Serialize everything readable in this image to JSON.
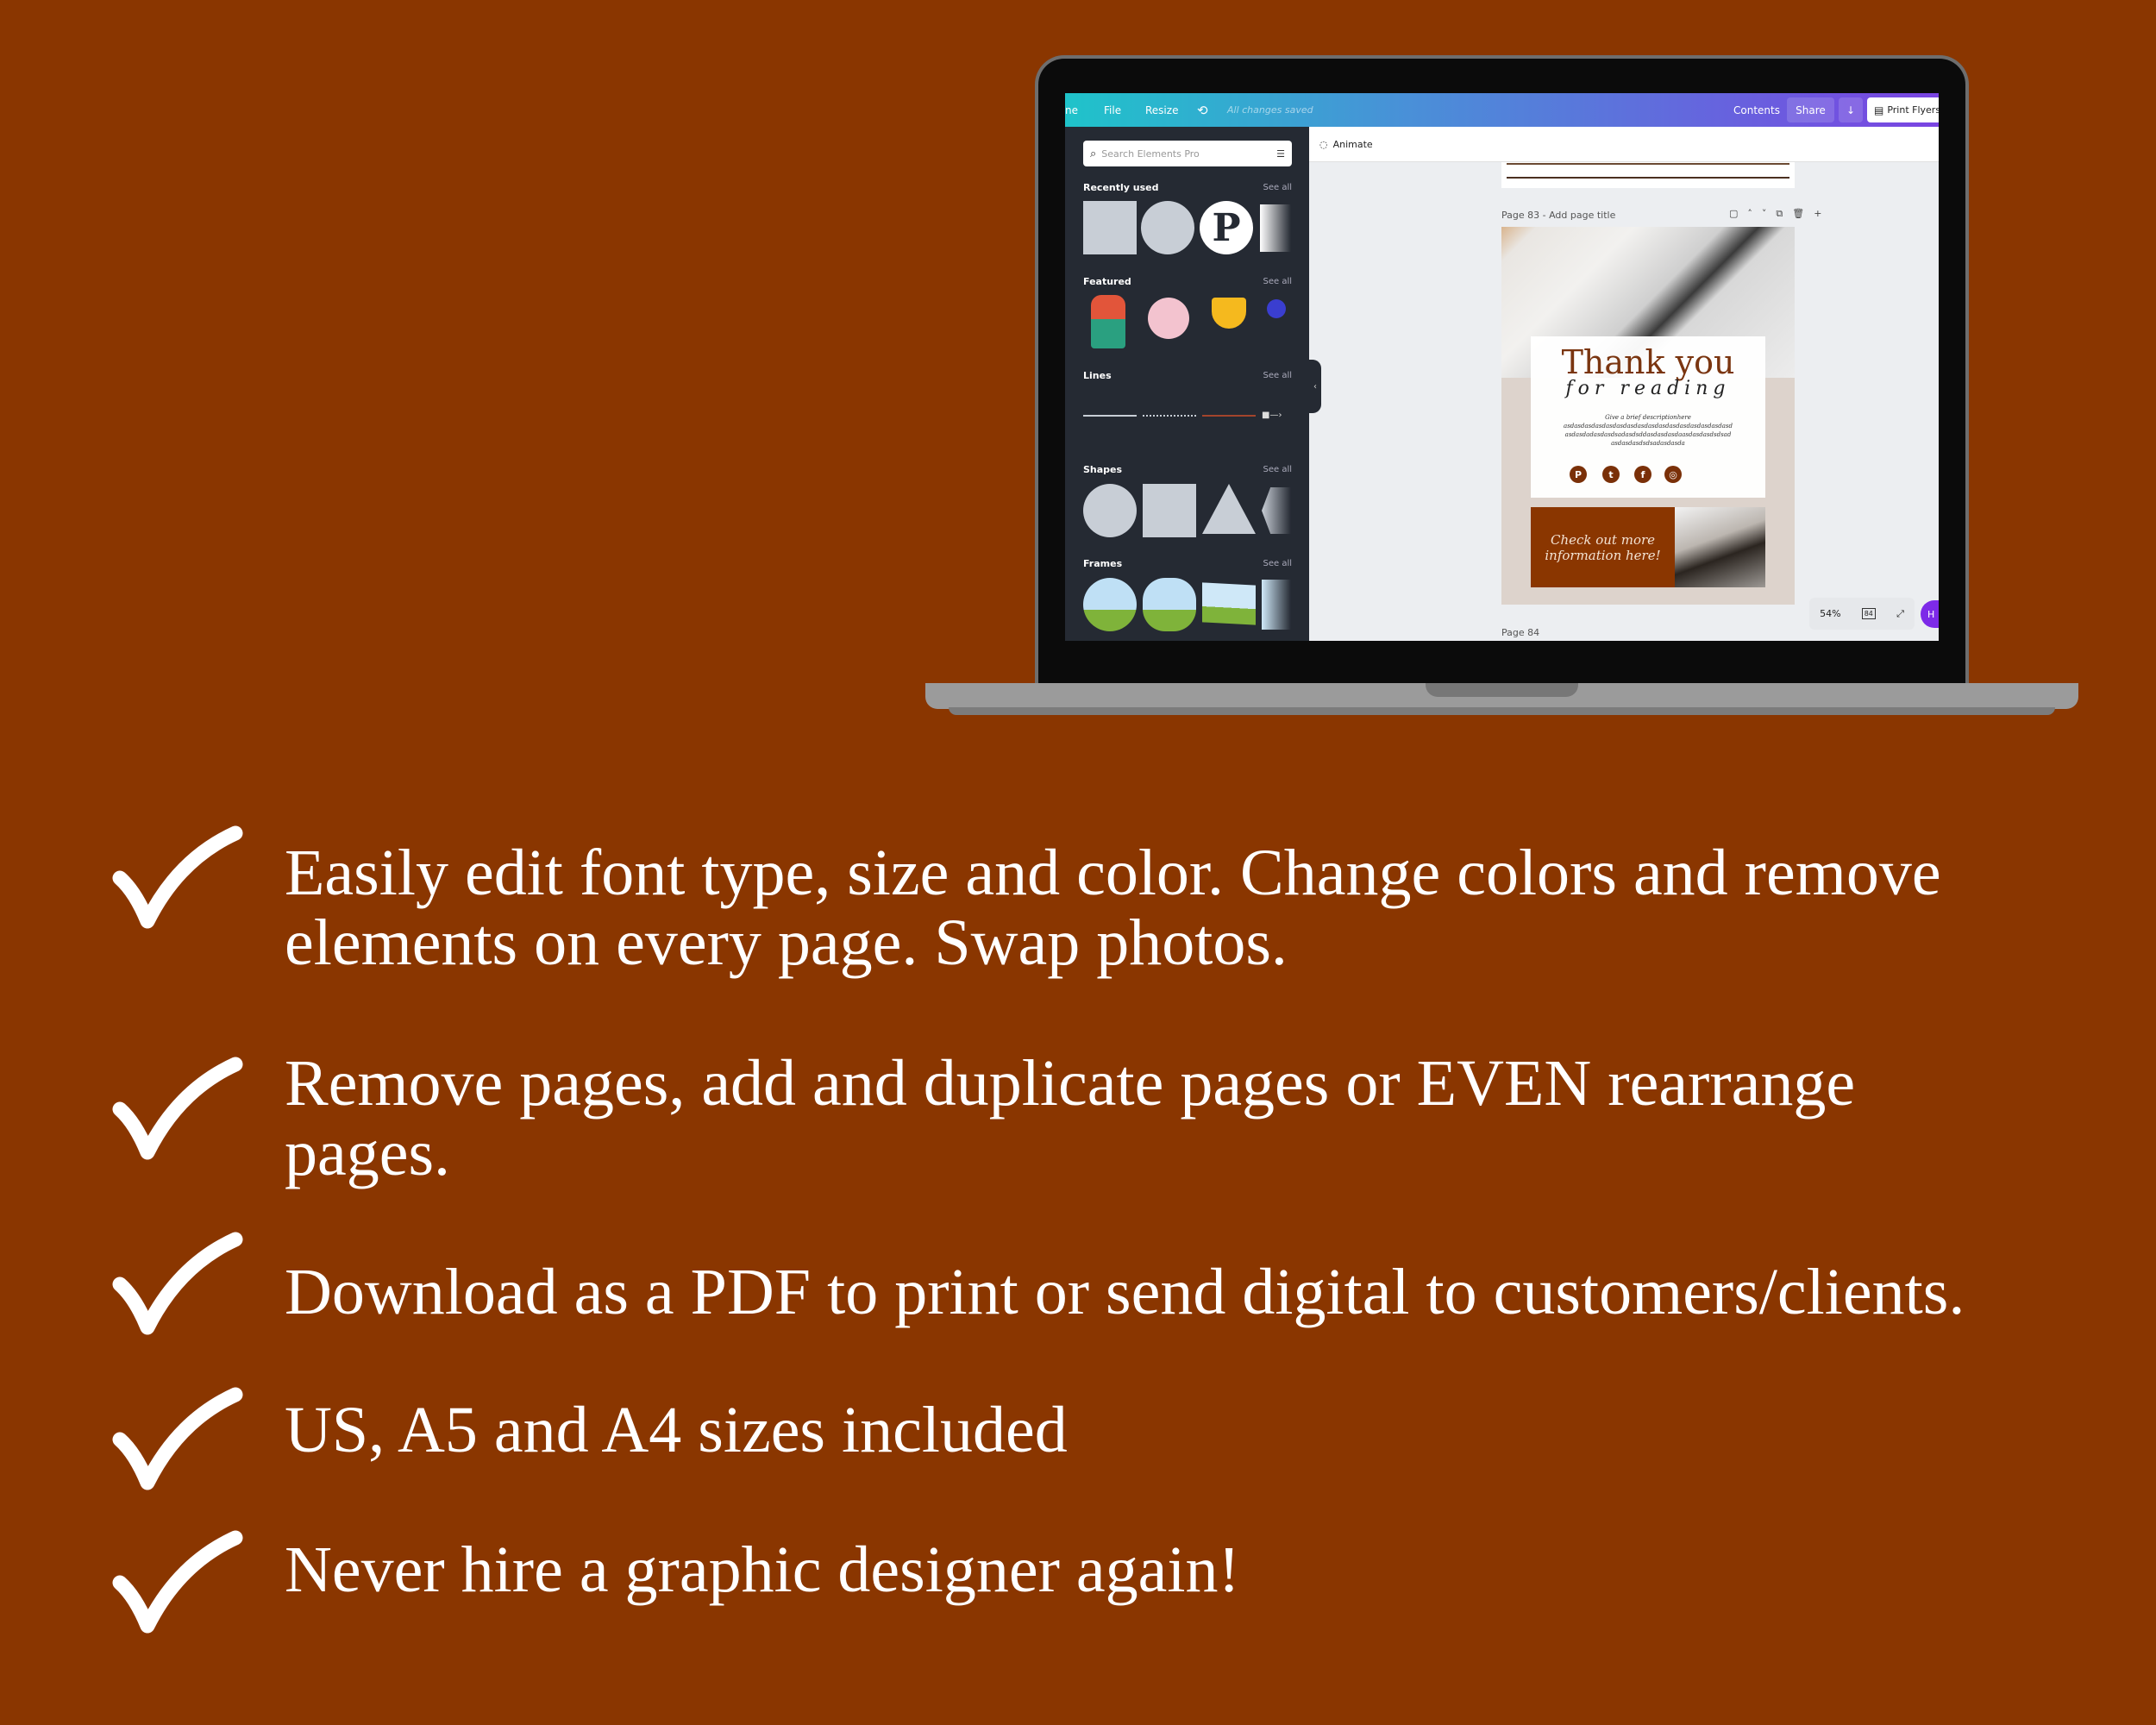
{
  "colors": {
    "background": "#8a3600",
    "canva_gradient_start": "#1fc3ca",
    "canva_gradient_end": "#7a44e2",
    "panel": "#252a33",
    "accent_brown": "#8a3600",
    "help_purple": "#7d2ae8"
  },
  "editor": {
    "topbar": {
      "home": "ne",
      "file": "File",
      "resize": "Resize",
      "undo_icon": "undo-icon",
      "status": "All changes saved",
      "contents": "Contents",
      "share": "Share",
      "download_icon": "download-icon",
      "print": "Print Flyers"
    },
    "search": {
      "placeholder": "Search Elements Pro"
    },
    "sections": [
      {
        "label": "Recently used",
        "see_all": "See all"
      },
      {
        "label": "Featured",
        "see_all": "See all"
      },
      {
        "label": "Lines",
        "see_all": "See all"
      },
      {
        "label": "Shapes",
        "see_all": "See all"
      },
      {
        "label": "Frames",
        "see_all": "See all"
      }
    ],
    "animate": "Animate",
    "page83_label": "Page 83 - Add page title",
    "page84_label": "Page 84",
    "zoom": "54%",
    "page_count": "84",
    "help": "H",
    "design": {
      "title": "Thank you",
      "subtitle": "for reading",
      "desc": [
        "Give a brief descriptionhere",
        "asdasdasdasdasdasdasdasdasdasdasdasdasdasdasdasd",
        "asdasdadasdasdsadasdsddasdasdasdaasdasdasdsdsad",
        "asdasdasdsdsadasdasda"
      ],
      "social": [
        "pinterest",
        "twitter",
        "facebook",
        "instagram"
      ],
      "cta": [
        "Check out more",
        "information here!"
      ]
    }
  },
  "bullets": [
    {
      "lines": [
        "Easily edit font type, size and color. Change colors and remove",
        "elements on every page. Swap photos."
      ]
    },
    {
      "lines": [
        "Remove pages, add and duplicate pages or EVEN rearrange",
        "pages."
      ]
    },
    {
      "lines": [
        "Download as a PDF to print or send digital to customers/clients."
      ]
    },
    {
      "lines": [
        "US, A5 and A4 sizes included"
      ]
    },
    {
      "lines": [
        "Never hire a graphic designer again!"
      ]
    }
  ]
}
